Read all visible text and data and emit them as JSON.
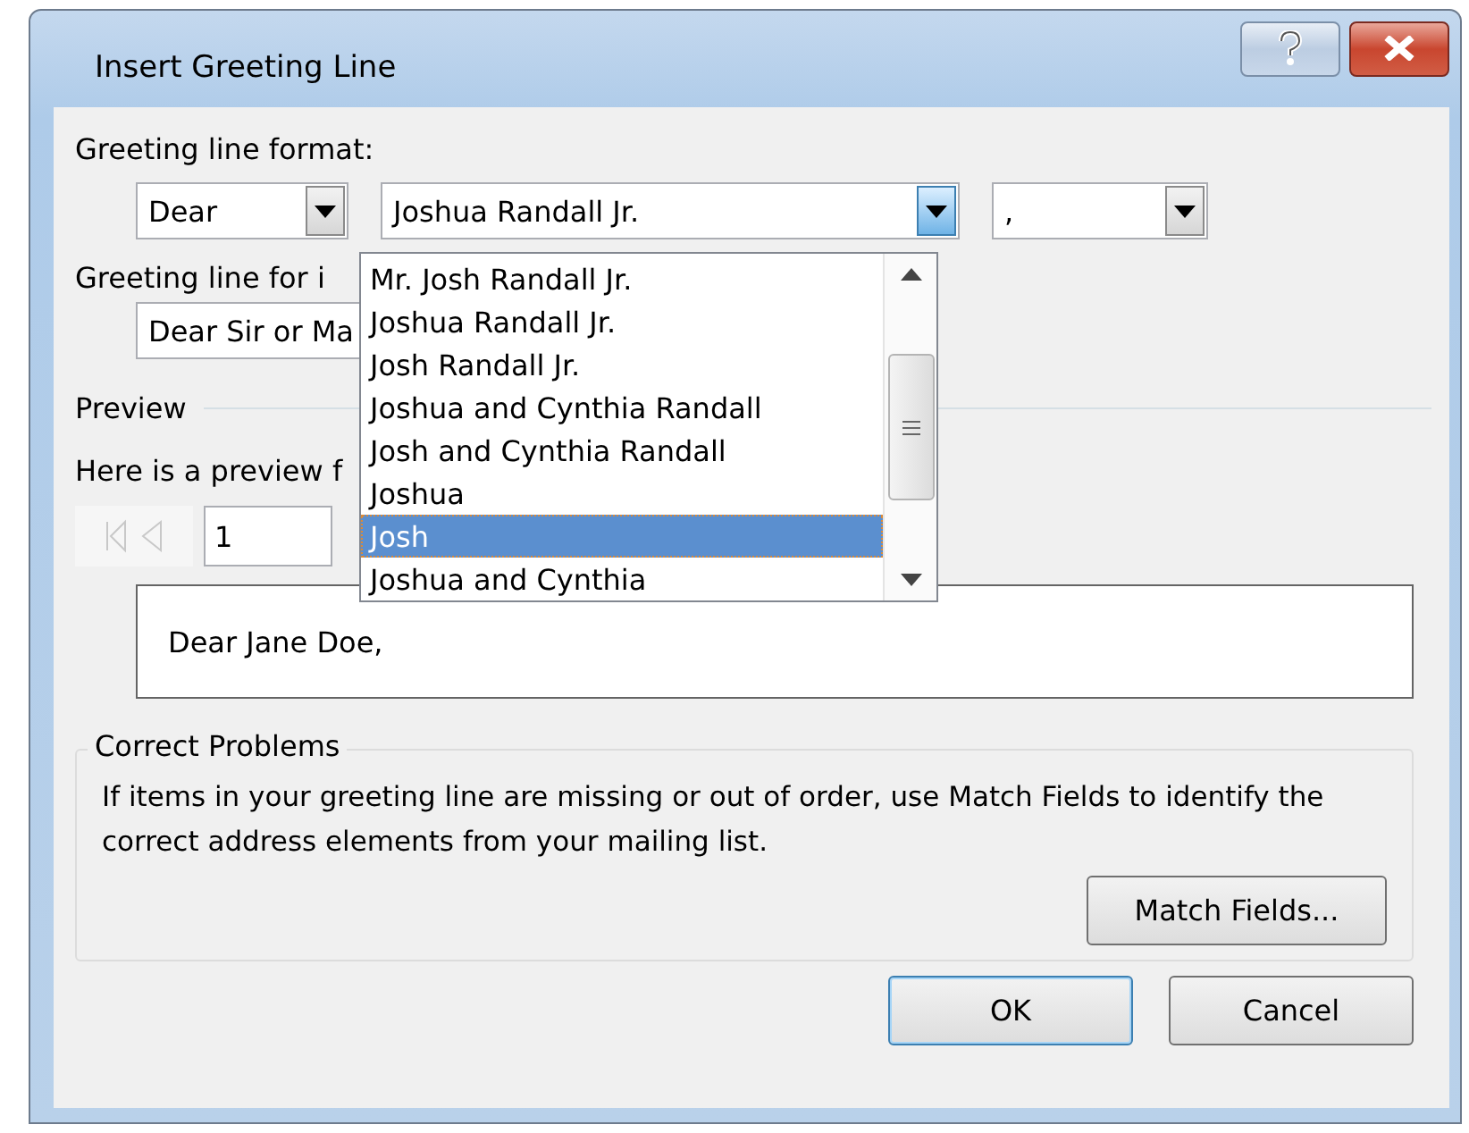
{
  "window": {
    "title": "Insert Greeting Line"
  },
  "greeting_format": {
    "label": "Greeting line format:",
    "salutation": "Dear",
    "name_format": "Joshua Randall Jr.",
    "punctuation": ",",
    "list_open": true,
    "name_options": [
      {
        "label": "Mr. Josh Randall Jr.",
        "selected": false
      },
      {
        "label": "Joshua Randall Jr.",
        "selected": false
      },
      {
        "label": "Josh Randall Jr.",
        "selected": false
      },
      {
        "label": "Joshua and Cynthia Randall",
        "selected": false
      },
      {
        "label": "Josh and Cynthia Randall",
        "selected": false
      },
      {
        "label": "Joshua",
        "selected": false
      },
      {
        "label": "Josh",
        "selected": true
      },
      {
        "label": "Joshua and Cynthia",
        "selected": false
      }
    ]
  },
  "invalid_recipients": {
    "label": "Greeting line for i",
    "value": "Dear Sir or Ma"
  },
  "preview": {
    "heading": "Preview",
    "intro": "Here is a preview f",
    "record": "1",
    "text": "Dear Jane Doe,"
  },
  "correct_problems": {
    "heading": "Correct Problems",
    "description": "If items in your greeting line are missing or out of order, use Match Fields to identify the correct address elements from your mailing list.",
    "button": "Match Fields..."
  },
  "buttons": [
    {
      "label": "OK",
      "default": true
    },
    {
      "label": "Cancel",
      "default": false
    }
  ]
}
